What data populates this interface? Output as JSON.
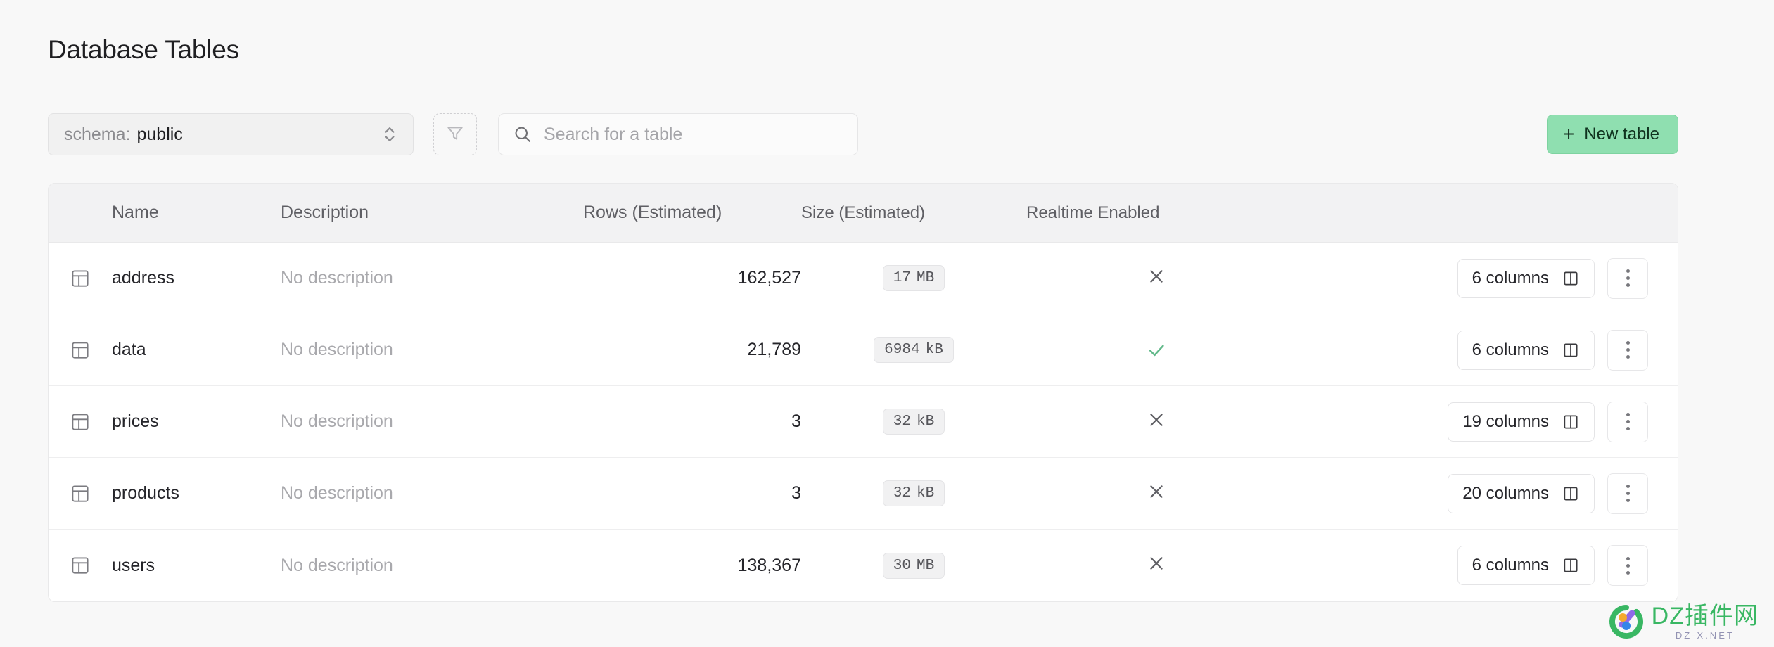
{
  "page": {
    "title": "Database Tables"
  },
  "toolbar": {
    "schema": {
      "prefix": "schema:",
      "value": "public",
      "chevron_icon": "chevron-up-down-icon"
    },
    "filter": {
      "icon": "filter-funnel-icon",
      "label": ""
    },
    "search": {
      "icon": "search-icon",
      "placeholder": "Search for a table",
      "value": ""
    },
    "new_table": {
      "plus": "+",
      "label": "New table",
      "bg_color": "#8fdfb0"
    }
  },
  "table": {
    "headers": {
      "icon": "",
      "name": "Name",
      "description": "Description",
      "rows": "Rows (Estimated)",
      "size": "Size (Estimated)",
      "realtime": "Realtime Enabled"
    },
    "rows": [
      {
        "icon": "table-icon",
        "name": "address",
        "description": "No description",
        "rows": "162,527",
        "size_value": "17",
        "size_unit": "MB",
        "realtime_enabled": false,
        "realtime_icon": "x-icon",
        "columns_label": "6 columns",
        "columns_icon": "columns-icon",
        "menu_icon": "vertical-dots-icon"
      },
      {
        "icon": "table-icon",
        "name": "data",
        "description": "No description",
        "rows": "21,789",
        "size_value": "6984",
        "size_unit": "kB",
        "realtime_enabled": true,
        "realtime_icon": "check-icon",
        "columns_label": "6 columns",
        "columns_icon": "columns-icon",
        "menu_icon": "vertical-dots-icon"
      },
      {
        "icon": "table-icon",
        "name": "prices",
        "description": "No description",
        "rows": "3",
        "size_value": "32",
        "size_unit": "kB",
        "realtime_enabled": false,
        "realtime_icon": "x-icon",
        "columns_label": "19 columns",
        "columns_icon": "columns-icon",
        "menu_icon": "vertical-dots-icon"
      },
      {
        "icon": "table-icon",
        "name": "products",
        "description": "No description",
        "rows": "3",
        "size_value": "32",
        "size_unit": "kB",
        "realtime_enabled": false,
        "realtime_icon": "x-icon",
        "columns_label": "20 columns",
        "columns_icon": "columns-icon",
        "menu_icon": "vertical-dots-icon"
      },
      {
        "icon": "table-icon",
        "name": "users",
        "description": "No description",
        "rows": "138,367",
        "size_value": "30",
        "size_unit": "MB",
        "realtime_enabled": false,
        "realtime_icon": "x-icon",
        "columns_label": "6 columns",
        "columns_icon": "columns-icon",
        "menu_icon": "vertical-dots-icon"
      }
    ]
  },
  "watermark": {
    "main": "DZ插件网",
    "sub": "DZ-X.NET",
    "color": "#2fb45c"
  },
  "glyphs": {
    "x": "×"
  }
}
